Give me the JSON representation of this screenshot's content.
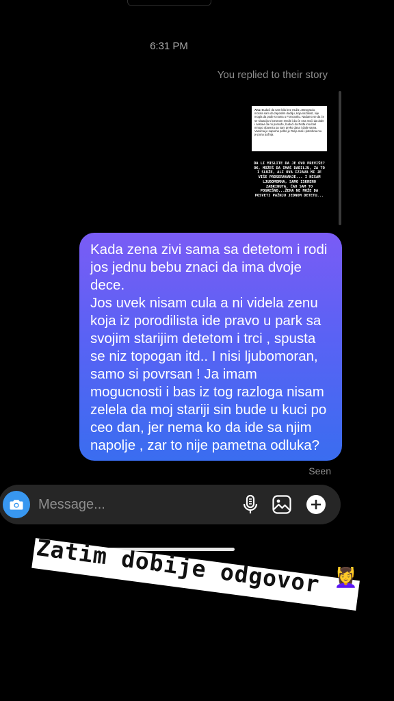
{
  "thread": {
    "timestamp": "6:31 PM",
    "replied_label": "You replied to their story",
    "seen_label": "Seen"
  },
  "story": {
    "card_author": "Ana:",
    "card_text": "Budući da sam bila bez muža u Beogradu, morala sam da zaposlim dadilju, koja nažalost, nije mogla da pođe s nama u Francusku. Nadamo se da će se situacija s koronom srediti i da će ona moći da dođe i nastavi da mi pomaže, budući da Peđa ima baš mnogo obaveza pa sam preko dana i dalje sama. Vasoma je naporno pošto je Relja mali i potrebna mu je puna pažnja.",
    "caption": "Da li mislite da je ovo previše? Ok, možeš da imaš dadilju, za to i služe, ali ova izjava mi je više proseravanje... I nisam ljubomorna, samo iskreno zabrinuta. Ćao sam to pogrešno...žena ne može da posveti pažnju jednom detetu..."
  },
  "message": {
    "text": "Kada zena zivi sama sa detetom i rodi jos jednu bebu  znaci da ima dvoje dece.\nJos uvek nisam cula a ni videla zenu koja iz porodilista ide pravo u park sa svojim starijim detetom i trci , spusta se niz topogan itd.. I nisi ljubomoran, samo si povrsan ! Ja imam mogucnosti i bas iz tog razloga nisam zelela da moj stariji sin bude u kuci po ceo dan, jer nema ko da ide sa njim napolje , zar to nije pametna odluka?",
    "gradient_colors": [
      "#7a5cf5",
      "#5a62f4",
      "#3a6df0"
    ]
  },
  "composer": {
    "placeholder": "Message...",
    "icons": [
      "camera-icon",
      "microphone-icon",
      "gallery-icon",
      "add-icon"
    ],
    "accent": "#3897f0"
  },
  "sticker": {
    "text": "Zatim dobije odgovor",
    "emoji": "💆‍♀️"
  }
}
